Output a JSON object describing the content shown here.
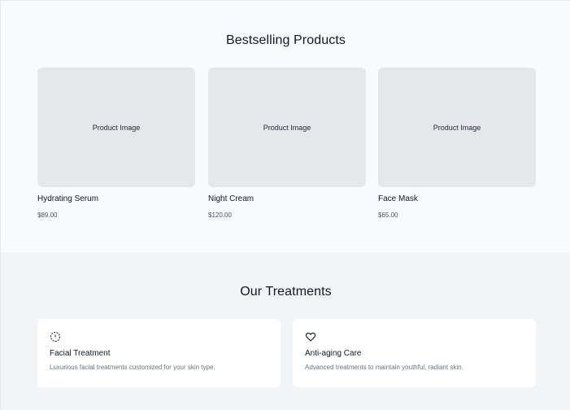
{
  "bestsellers": {
    "title": "Bestselling Products",
    "products": [
      {
        "image_label": "Product Image",
        "name": "Hydrating Serum",
        "price": "$89.00"
      },
      {
        "image_label": "Product Image",
        "name": "Night Cream",
        "price": "$120.00"
      },
      {
        "image_label": "Product Image",
        "name": "Face Mask",
        "price": "$65.00"
      }
    ]
  },
  "treatments": {
    "title": "Our Treatments",
    "items": [
      {
        "icon": "sparkle-icon",
        "title": "Facial Treatment",
        "description": "Luxurious facial treatments customized for your skin type."
      },
      {
        "icon": "heart-icon",
        "title": "Anti-aging Care",
        "description": "Advanced treatments to maintain youthful, radiant skin."
      }
    ]
  }
}
